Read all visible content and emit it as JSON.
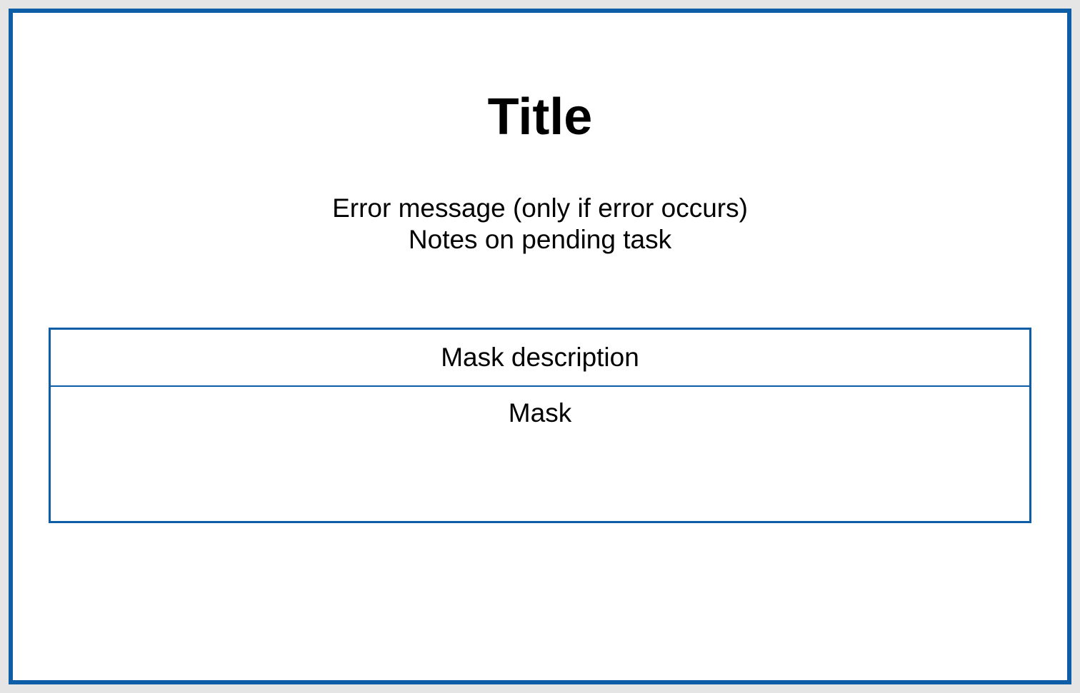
{
  "title": "Title",
  "messages": {
    "error": "Error message (only if error occurs)",
    "notes": "Notes on pending task"
  },
  "maskBox": {
    "description": "Mask description",
    "content": "Mask"
  },
  "colors": {
    "border": "#0d5ea6",
    "background_page": "#e5e5e5",
    "background_panel": "#ffffff"
  }
}
